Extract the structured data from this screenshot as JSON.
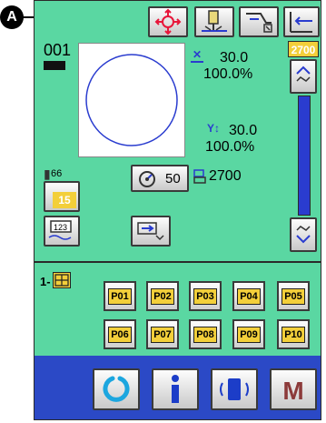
{
  "callout": {
    "label": "A"
  },
  "pattern": {
    "number": "001"
  },
  "scale_x": {
    "size": "30.0",
    "percent": "100.0%"
  },
  "scale_y": {
    "size": "30.0",
    "percent": "100.0%"
  },
  "right_panel": {
    "count_badge": "2700"
  },
  "tension": {
    "thread_value": "66",
    "badge_value": "15"
  },
  "speed": {
    "value": "50"
  },
  "counter": {
    "value": "2700"
  },
  "pattern_register": {
    "group_label": "1-",
    "row1": [
      "P01",
      "P02",
      "P03",
      "P04",
      "P05"
    ],
    "row2": [
      "P06",
      "P07",
      "P08",
      "P09",
      "P10"
    ]
  },
  "bottom_bar": {
    "menu_label": "M"
  },
  "colors": {
    "screen_bg": "#5ad7a2",
    "bottom_bar": "#2b49c6",
    "badge_yellow": "#f3cf3a",
    "highlight_red": "#e8163a",
    "circle_blue": "#2a3ccf"
  }
}
